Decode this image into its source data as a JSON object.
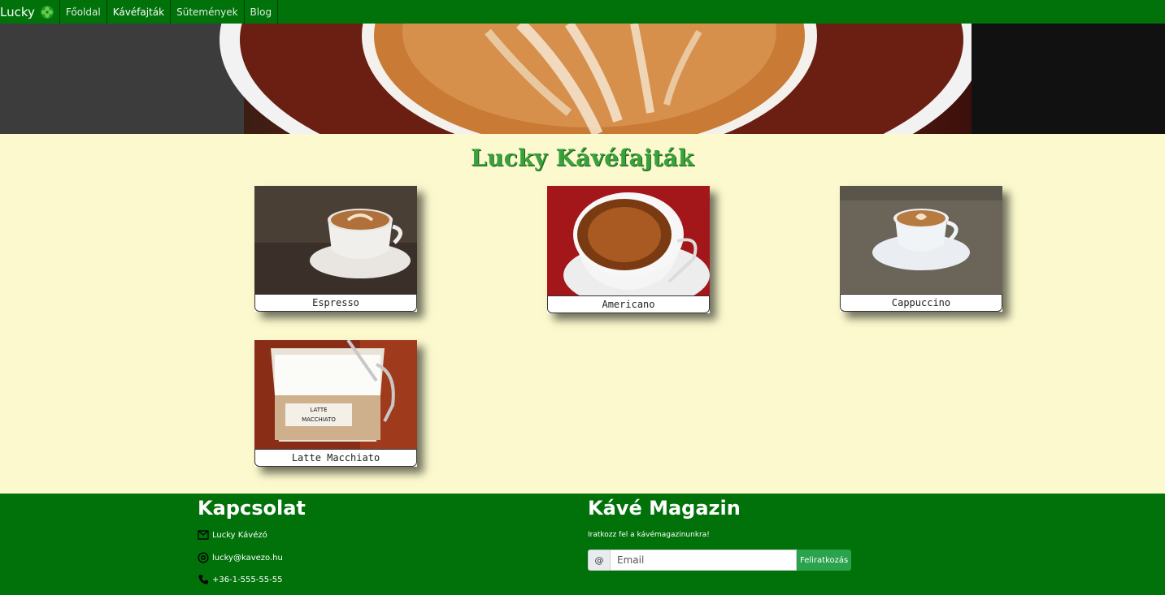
{
  "nav": {
    "brand": "Lucky",
    "items": [
      {
        "label": "Főoldal",
        "active": false
      },
      {
        "label": "Kávéfajták",
        "active": true
      },
      {
        "label": "Sütemények",
        "active": false
      },
      {
        "label": "Blog",
        "active": false
      }
    ]
  },
  "main": {
    "title": "Lucky Kávéfajták",
    "cards": [
      {
        "label": "Espresso"
      },
      {
        "label": "Americano"
      },
      {
        "label": "Cappuccino"
      },
      {
        "label": "Latte Macchiato"
      }
    ]
  },
  "footer": {
    "contact": {
      "title": "Kapcsolat",
      "name": "Lucky Kávézó",
      "email": "lucky@kavezo.hu",
      "phone": "+36-1-555-55-55"
    },
    "magazine": {
      "title": "Kávé Magazin",
      "text": "Iratkozz fel a kávémagazinunkra!",
      "at_symbol": "@",
      "email_placeholder": "Email",
      "button": "Feliratkozás"
    }
  },
  "colors": {
    "nav_green": "#007209",
    "background": "#fbf9cd",
    "title_green": "#3aa23a",
    "button_green": "#2ba24c"
  }
}
